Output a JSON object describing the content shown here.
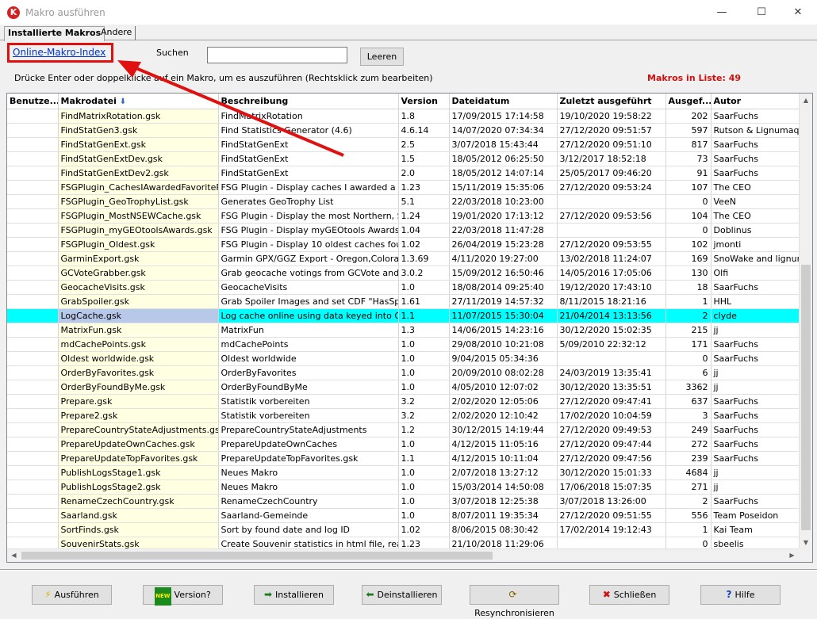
{
  "window": {
    "title": "Makro ausführen",
    "app_icon": "K",
    "min_glyph": "—",
    "max_glyph": "☐",
    "close_glyph": "✕"
  },
  "tabs": [
    {
      "label": "Installierte Makros",
      "active": true
    },
    {
      "label": "Andere",
      "active": false
    }
  ],
  "toolbar": {
    "online_link": "Online-Makro-Index",
    "search_label": "Suchen",
    "search_value": "",
    "clear_label": "Leeren",
    "hint": "Drücke Enter oder doppelklicke auf ein Makro, um es auszuführen (Rechtsklick zum bearbeiten)",
    "count_label": "Makros in Liste: 49"
  },
  "annotation_color": "#e01010",
  "table": {
    "columns": [
      "Benutze...",
      "Makrodatei",
      "Beschreibung",
      "Version",
      "Dateidatum",
      "Zuletzt ausgeführt",
      "Ausgef...",
      "Autor"
    ],
    "sort_column": "Makrodatei",
    "selected_row": 14,
    "rows": [
      [
        "",
        "FindMatrixRotation.gsk",
        "FindMatrixRotation",
        "1.8",
        "17/09/2015 17:14:58",
        "19/10/2020 19:58:22",
        "202",
        "SaarFuchs"
      ],
      [
        "",
        "FindStatGen3.gsk",
        "Find Statistics Generator (4.6)",
        "4.6.14",
        "14/07/2020 07:34:34",
        "27/12/2020 09:51:57",
        "597",
        "Rutson & Lignumaqua"
      ],
      [
        "",
        "FindStatGenExt.gsk",
        "FindStatGenExt",
        "2.5",
        "3/07/2018 15:43:44",
        "27/12/2020 09:51:10",
        "817",
        "SaarFuchs"
      ],
      [
        "",
        "FindStatGenExtDev.gsk",
        "FindStatGenExt",
        "1.5",
        "18/05/2012 06:25:50",
        "3/12/2017 18:52:18",
        "73",
        "SaarFuchs"
      ],
      [
        "",
        "FindStatGenExtDev2.gsk",
        "FindStatGenExt",
        "2.0",
        "18/05/2012 14:07:14",
        "25/05/2017 09:46:20",
        "91",
        "SaarFuchs"
      ],
      [
        "",
        "FSGPlugin_CachesIAwardedFavoriteP...",
        "FSG Plugin - Display caches I awarded a fa...",
        "1.23",
        "15/11/2019 15:35:06",
        "27/12/2020 09:53:24",
        "107",
        "The CEO"
      ],
      [
        "",
        "FSGPlugin_GeoTrophyList.gsk",
        "Generates GeoTrophy List",
        "5.1",
        "22/03/2018 10:23:00",
        "",
        "0",
        "VeeN"
      ],
      [
        "",
        "FSGPlugin_MostNSEWCache.gsk",
        "FSG Plugin - Display the most Northern, So...",
        "1.24",
        "19/01/2020 17:13:12",
        "27/12/2020 09:53:56",
        "104",
        "The CEO"
      ],
      [
        "",
        "FSGPlugin_myGEOtoolsAwards.gsk",
        "FSG Plugin - Display myGEOtools Awards Ba...",
        "1.04",
        "22/03/2018 11:47:28",
        "",
        "0",
        "Doblinus"
      ],
      [
        "",
        "FSGPlugin_Oldest.gsk",
        "FSG Plugin - Display 10 oldest caches found",
        "1.02",
        "26/04/2019 15:23:28",
        "27/12/2020 09:53:55",
        "102",
        "jmonti"
      ],
      [
        "",
        "GarminExport.gsk",
        "Garmin GPX/GGZ Export  - Oregon,Colorad...",
        "1.3.69",
        "4/11/2020 19:27:00",
        "13/02/2018 11:24:07",
        "169",
        "SnoWake and lignumaqua"
      ],
      [
        "",
        "GCVoteGrabber.gsk",
        "Grab geocache votings from GCVote and a...",
        "3.0.2",
        "15/09/2012 16:50:46",
        "14/05/2016 17:05:06",
        "130",
        "Olfi"
      ],
      [
        "",
        "GeocacheVisits.gsk",
        "GeocacheVisits",
        "1.0",
        "18/08/2014 09:25:40",
        "19/12/2020 17:43:10",
        "18",
        "SaarFuchs"
      ],
      [
        "",
        "GrabSpoiler.gsk",
        "Grab Spoiler Images and set CDF \"HasSpoil...",
        "1.61",
        "27/11/2019 14:57:32",
        "8/11/2015 18:21:16",
        "1",
        "HHL"
      ],
      [
        "",
        "LogCache.gsk",
        "Log cache online using data keyed into GSA...",
        "1.1",
        "11/07/2015 15:30:04",
        "21/04/2014 13:13:56",
        "2",
        "clyde"
      ],
      [
        "",
        "MatrixFun.gsk",
        "MatrixFun",
        "1.3",
        "14/06/2015 14:23:16",
        "30/12/2020 15:02:35",
        "215",
        "jj"
      ],
      [
        "",
        "mdCachePoints.gsk",
        "mdCachePoints",
        "1.0",
        "29/08/2010 10:21:08",
        "5/09/2010 22:32:12",
        "171",
        "SaarFuchs"
      ],
      [
        "",
        "Oldest worldwide.gsk",
        "Oldest worldwide",
        "1.0",
        "9/04/2015 05:34:36",
        "",
        "0",
        "SaarFuchs"
      ],
      [
        "",
        "OrderByFavorites.gsk",
        "OrderByFavorites",
        "1.0",
        "20/09/2010 08:02:28",
        "24/03/2019 13:35:41",
        "6",
        "jj"
      ],
      [
        "",
        "OrderByFoundByMe.gsk",
        "OrderByFoundByMe",
        "1.0",
        "4/05/2010 12:07:02",
        "30/12/2020 13:35:51",
        "3362",
        "jj"
      ],
      [
        "",
        "Prepare.gsk",
        "Statistik vorbereiten",
        "3.2",
        "2/02/2020 12:05:06",
        "27/12/2020 09:47:41",
        "637",
        "SaarFuchs"
      ],
      [
        "",
        "Prepare2.gsk",
        "Statistik vorbereiten",
        "3.2",
        "2/02/2020 12:10:42",
        "17/02/2020 10:04:59",
        "3",
        "SaarFuchs"
      ],
      [
        "",
        "PrepareCountryStateAdjustments.gsk",
        "PrepareCountryStateAdjustments",
        "1.2",
        "30/12/2015 14:19:44",
        "27/12/2020 09:49:53",
        "249",
        "SaarFuchs"
      ],
      [
        "",
        "PrepareUpdateOwnCaches.gsk",
        "PrepareUpdateOwnCaches",
        "1.0",
        "4/12/2015 11:05:16",
        "27/12/2020 09:47:44",
        "272",
        "SaarFuchs"
      ],
      [
        "",
        "PrepareUpdateTopFavorites.gsk",
        "PrepareUpdateTopFavorites.gsk",
        "1.1",
        "4/12/2015 10:11:04",
        "27/12/2020 09:47:56",
        "239",
        "SaarFuchs"
      ],
      [
        "",
        "PublishLogsStage1.gsk",
        "Neues Makro",
        "1.0",
        "2/07/2018 13:27:12",
        "30/12/2020 15:01:33",
        "4684",
        "jj"
      ],
      [
        "",
        "PublishLogsStage2.gsk",
        "Neues Makro",
        "1.0",
        "15/03/2014 14:50:08",
        "17/06/2018 15:07:35",
        "271",
        "jj"
      ],
      [
        "",
        "RenameCzechCountry.gsk",
        "RenameCzechCountry",
        "1.0",
        "3/07/2018 12:25:38",
        "3/07/2018 13:26:00",
        "2",
        "SaarFuchs"
      ],
      [
        "",
        "Saarland.gsk",
        "Saarland-Gemeinde",
        "1.0",
        "8/07/2011 19:35:34",
        "27/12/2020 09:51:55",
        "556",
        "Team Poseidon"
      ],
      [
        "",
        "SortFinds.gsk",
        "Sort by found date and log ID",
        "1.02",
        "8/06/2015 08:30:42",
        "17/02/2014 19:12:43",
        "1",
        "Kai Team"
      ],
      [
        "",
        "SouvenirStats.gsk",
        "Create Souvenir statistics in html file, ready...",
        "1.23",
        "21/10/2018 11:29:06",
        "",
        "0",
        "sbeelis"
      ]
    ]
  },
  "buttons": {
    "run": {
      "label": "Ausführen",
      "icon": "lightning-icon"
    },
    "version": {
      "label": "Version?",
      "icon": "new-badge-icon",
      "badge": "NEW"
    },
    "install": {
      "label": "Installieren",
      "icon": "arrow-right-icon"
    },
    "uninstall": {
      "label": "Deinstallieren",
      "icon": "arrow-left-icon"
    },
    "resync": {
      "label": "Resynchronisieren",
      "icon": "sync-icon"
    },
    "close": {
      "label": "Schließen",
      "icon": "red-x-icon"
    },
    "help": {
      "label": "Hilfe",
      "icon": "question-icon"
    }
  }
}
